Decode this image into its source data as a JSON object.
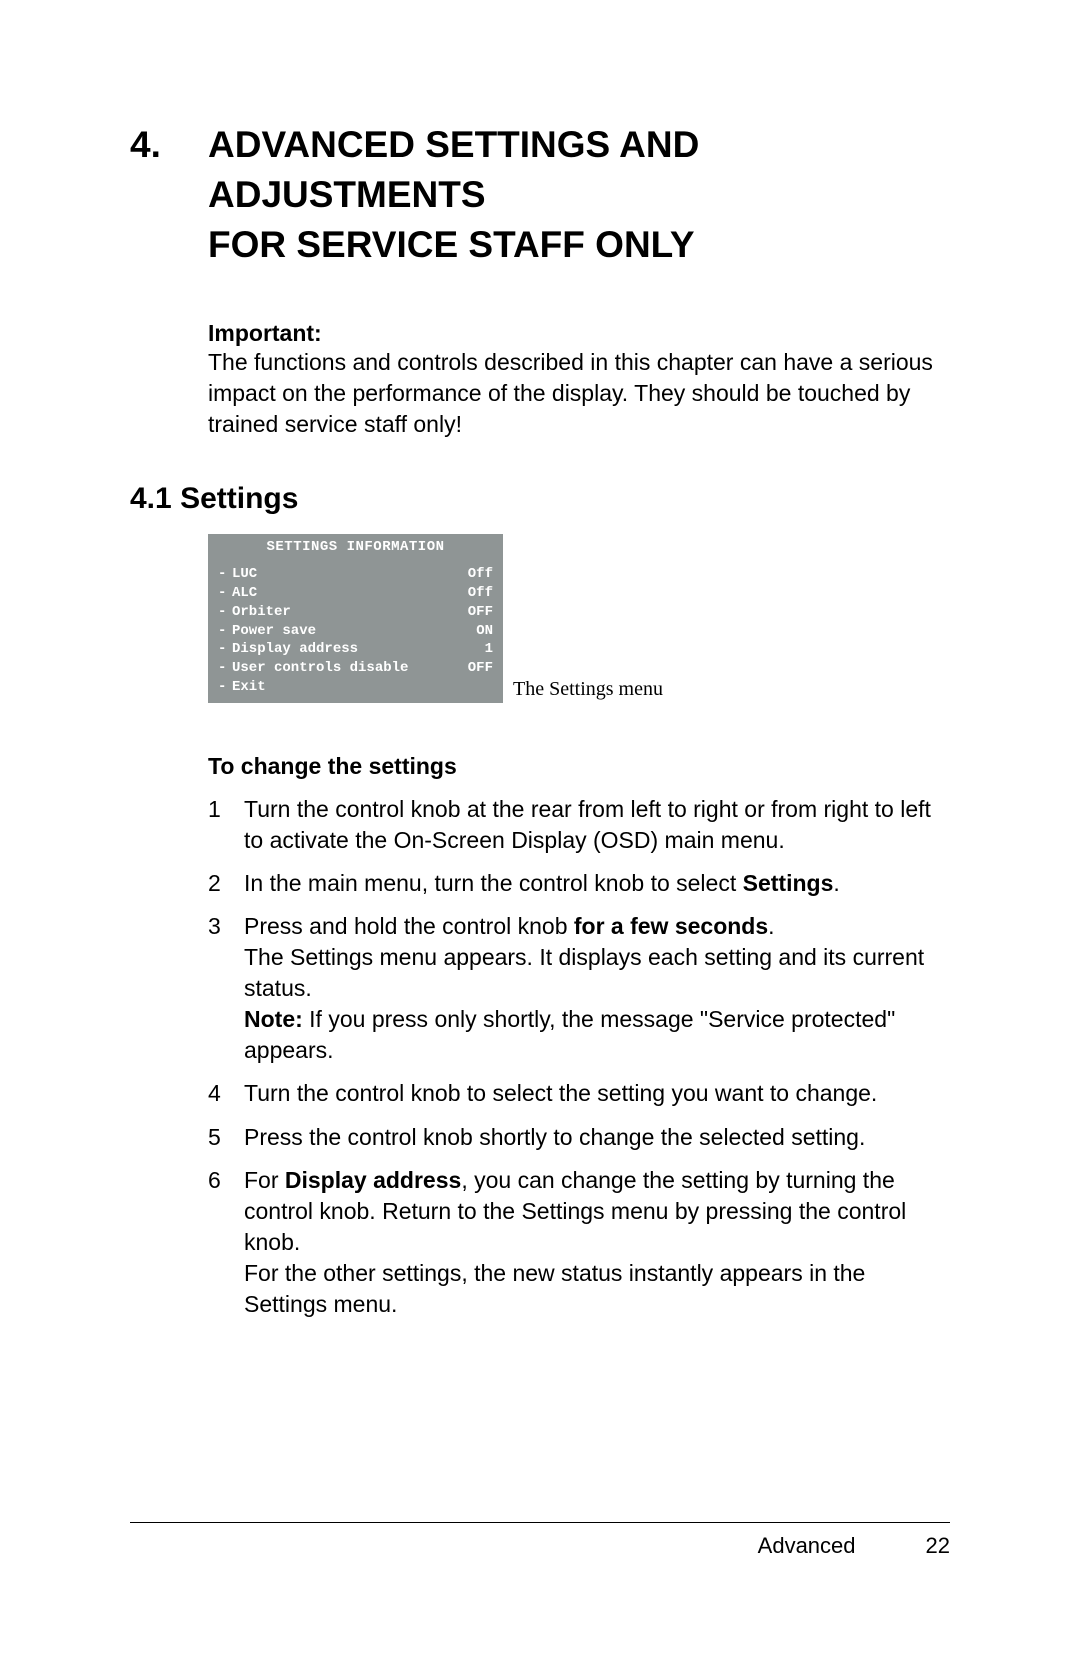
{
  "chapter": {
    "number": "4.",
    "title_line1": "ADVANCED SETTINGS AND ADJUSTMENTS",
    "title_line2": "FOR SERVICE STAFF ONLY"
  },
  "important": {
    "label": "Important:",
    "text": "The functions and controls described in this chapter can have a serious impact on the performance of the display. They should be touched by trained service staff only!"
  },
  "section": {
    "number": "4.1",
    "title": "Settings"
  },
  "osd": {
    "header": "SETTINGS INFORMATION",
    "rows": [
      {
        "label": "LUC",
        "value": "Off"
      },
      {
        "label": "ALC",
        "value": "Off"
      },
      {
        "label": "Orbiter",
        "value": "OFF"
      },
      {
        "label": "Power save",
        "value": "ON"
      },
      {
        "label": "Display address",
        "value": "1"
      },
      {
        "label": "User controls disable",
        "value": "OFF"
      },
      {
        "label": "Exit",
        "value": ""
      }
    ],
    "caption": "The Settings menu"
  },
  "subheading": "To change the settings",
  "steps": {
    "s1": "Turn the control knob at the rear from left to right or from right to left to activate the On-Screen Display (OSD) main menu.",
    "s2a": "In the main menu, turn the control knob to select ",
    "s2b": "Settings",
    "s2c": ".",
    "s3a": "Press and hold the control knob ",
    "s3b": "for a few seconds",
    "s3c": ".",
    "s3d": "The Settings menu appears. It displays each setting and its current status.",
    "s3e": "Note:",
    "s3f": " If you press only shortly, the message \"Service protected\" appears.",
    "s4": "Turn the control knob to select the setting you want to change.",
    "s5": "Press the control knob shortly to change the selected setting.",
    "s6a": "For ",
    "s6b": "Display address",
    "s6c": ", you can change the setting by turning the control knob. Return to the Settings menu by pressing the control knob.",
    "s6d": "For the other settings, the new status instantly appears in the Settings menu."
  },
  "footer": {
    "label": "Advanced",
    "page": "22"
  }
}
